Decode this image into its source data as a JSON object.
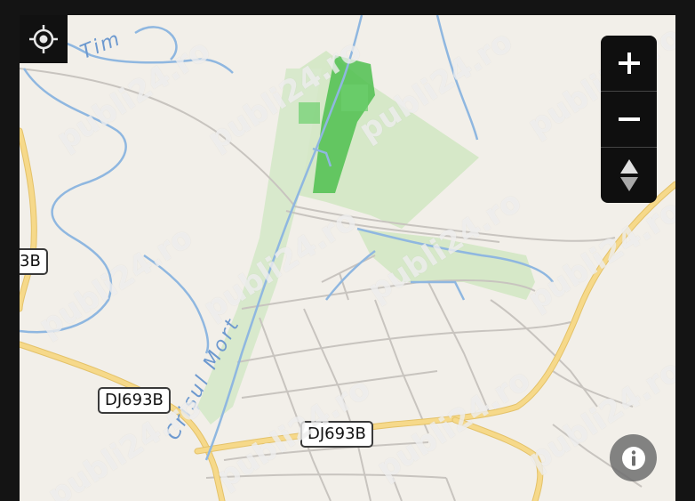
{
  "map": {
    "road_labels": [
      "3B",
      "DJ693B",
      "DJ693B"
    ],
    "water_labels": [
      "Tim",
      "Crișul Mort"
    ],
    "watermark": "publi24.ro"
  },
  "controls": {
    "locate_icon": "crosshair-icon",
    "zoom_in_icon": "plus-icon",
    "zoom_out_icon": "minus-icon",
    "rotate_icon": "up-down-arrows-icon",
    "info_icon": "info-icon"
  },
  "colors": {
    "land": "#f2efe9",
    "road_major": "#f6d98a",
    "river": "#8fb7e0",
    "forest": "#cfe3c2",
    "forest_dark": "#4fbf4f",
    "controls_bg": "#0f0f0f"
  }
}
